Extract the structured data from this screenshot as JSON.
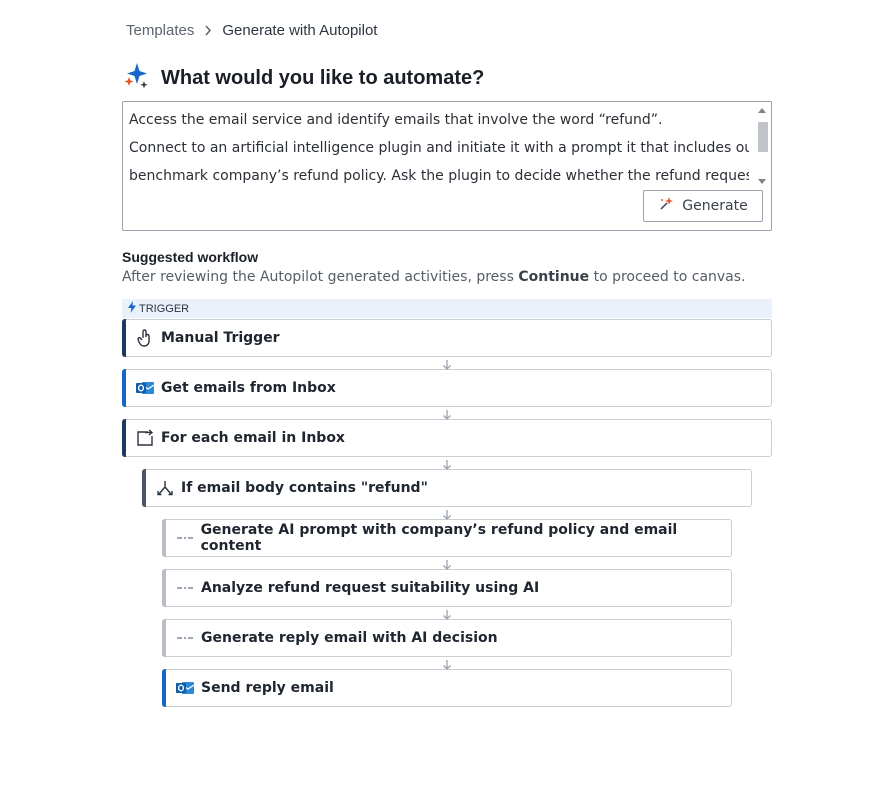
{
  "breadcrumb": {
    "root": "Templates",
    "current": "Generate with Autopilot"
  },
  "title": "What would you like to automate?",
  "prompt": {
    "lines": [
      "Access the email service and identify emails that involve the word “refund”.",
      "Connect to an artificial intelligence plugin and initiate it with a prompt it that includes our",
      "benchmark company’s refund policy. Ask the plugin to decide whether the refund request"
    ]
  },
  "generate_label": "Generate",
  "suggested": {
    "title": "Suggested workflow",
    "sub_before": "After reviewing the Autopilot generated activities, press ",
    "sub_bold": "Continue",
    "sub_after": " to proceed to canvas."
  },
  "trigger_label": "TRIGGER",
  "steps": [
    {
      "label": "Manual Trigger",
      "icon": "hand-pointer-icon"
    },
    {
      "label": "Get emails from Inbox",
      "icon": "outlook-icon"
    },
    {
      "label": "For each email in Inbox",
      "icon": "loop-icon"
    },
    {
      "label": "If email body contains \"refund\"",
      "icon": "branch-icon"
    },
    {
      "label": "Generate AI prompt with company’s refund policy and email content",
      "icon": "ai-icon"
    },
    {
      "label": "Analyze refund request suitability using AI",
      "icon": "ai-icon"
    },
    {
      "label": "Generate reply email with AI decision",
      "icon": "ai-icon"
    },
    {
      "label": "Send reply email",
      "icon": "outlook-icon"
    }
  ],
  "colors": {
    "accent_blue": "#1667c8",
    "navy": "#1a3a63",
    "sparkle_orange": "#e8552d"
  }
}
